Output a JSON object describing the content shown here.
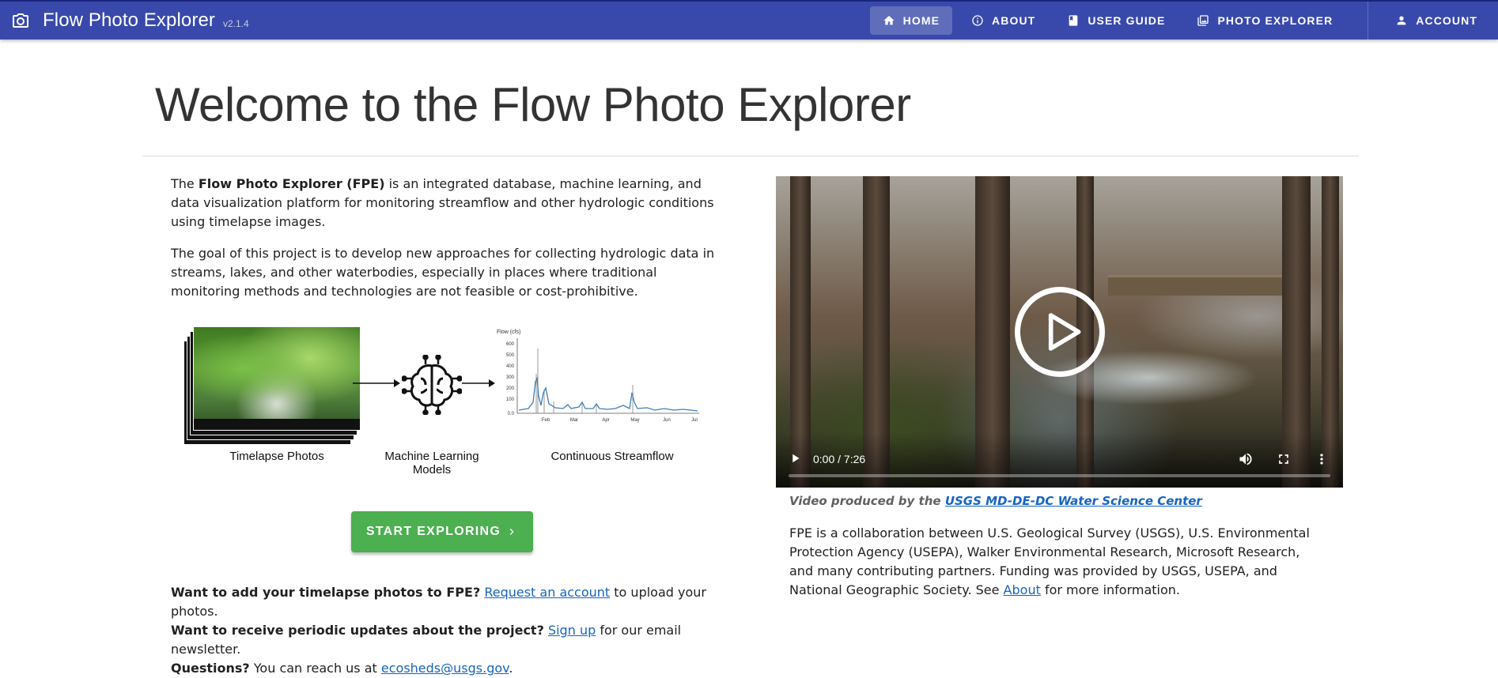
{
  "app": {
    "title": "Flow Photo Explorer",
    "version": "v2.1.4",
    "brand_color": "#3949ab"
  },
  "nav": {
    "items": [
      {
        "label": "HOME",
        "icon": "home-icon",
        "active": true
      },
      {
        "label": "ABOUT",
        "icon": "info-icon",
        "active": false
      },
      {
        "label": "USER GUIDE",
        "icon": "book-icon",
        "active": false
      },
      {
        "label": "PHOTO EXPLORER",
        "icon": "photo-library-icon",
        "active": false
      }
    ],
    "account": {
      "label": "ACCOUNT",
      "icon": "account-icon"
    }
  },
  "main": {
    "title_prefix": "Welcome to the",
    "title_name": "Flow Photo Explorer",
    "intro": {
      "pre": "The ",
      "bold": "Flow Photo Explorer (FPE)",
      "post": " is an integrated database, machine learning, and data visualization platform for monitoring streamflow and other hydrologic conditions using timelapse images."
    },
    "goal": "The goal of this project is to develop new approaches for collecting hydrologic data in streams, lakes, and other waterbodies, especially in places where traditional monitoring methods and technologies are not feasible or cost-prohibitive.",
    "diagram": {
      "step1": "Timelapse Photos",
      "step2": "Machine Learning Models",
      "step3": "Continuous Streamflow",
      "chart_ylabel": "Flow (cfs)",
      "chart_yticks": [
        "600",
        "500",
        "400",
        "300",
        "200",
        "100",
        "0.0"
      ],
      "chart_xticks": [
        "Feb",
        "Mar",
        "Apr",
        "May",
        "Jun",
        "Jul"
      ]
    },
    "cta_label": "START EXPLORING",
    "faq": {
      "q1": "Want to add your timelapse photos to FPE?",
      "q1_link": "Request an account",
      "q1_rest": " to upload your photos.",
      "q2": "Want to receive periodic updates about the project?",
      "q2_link": "Sign up",
      "q2_rest": " for our email newsletter.",
      "q3": "Questions?",
      "q3_text": " You can reach us at ",
      "q3_link": "ecosheds@usgs.gov",
      "q3_end": "."
    }
  },
  "video": {
    "time": "0:00 / 7:26",
    "progress": 0,
    "caption_prefix": "Video produced by the",
    "caption_link": "USGS MD-DE-DC Water Science Center"
  },
  "collab": {
    "text": "FPE is a collaboration between U.S. Geological Survey (USGS), U.S. Environmental Protection Agency (USEPA), Walker Environmental Research, Microsoft Research, and many contributing partners. Funding was provided by USGS, USEPA, and National Geographic Society. See ",
    "link": "About",
    "end": " for more information."
  }
}
